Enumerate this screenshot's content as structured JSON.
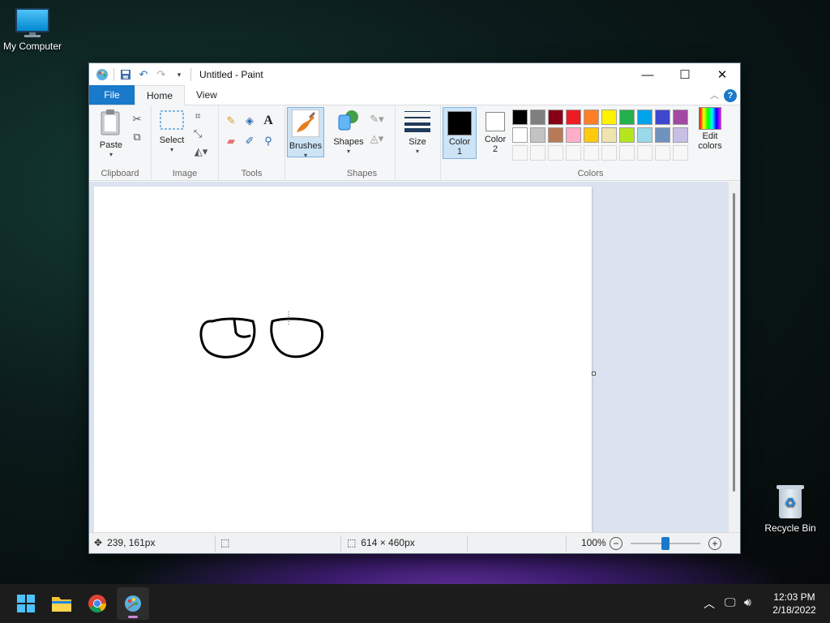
{
  "desktop": {
    "icons": [
      {
        "label": "My Computer",
        "icon": "computer-icon"
      },
      {
        "label": "Recycle Bin",
        "icon": "recycle-bin-icon"
      }
    ]
  },
  "window": {
    "title": "Untitled - Paint",
    "tabs": [
      "File",
      "Home",
      "View"
    ],
    "groups": {
      "clipboard": {
        "label": "Clipboard",
        "paste": "Paste"
      },
      "image": {
        "label": "Image",
        "select": "Select"
      },
      "tools": {
        "label": "Tools"
      },
      "brushes": {
        "label": "Brushes"
      },
      "shapes": {
        "label": "Shapes",
        "shapes_btn": "Shapes"
      },
      "size": {
        "label": "Size"
      },
      "colors": {
        "label": "Colors",
        "color1_line1": "Color",
        "color1_line2": "1",
        "color2_line1": "Color",
        "color2_line2": "2",
        "edit_line1": "Edit",
        "edit_line2": "colors",
        "color1": "#000000",
        "color2": "#ffffff",
        "palette_row1": [
          "#000000",
          "#7f7f7f",
          "#880015",
          "#ed1c24",
          "#ff7f27",
          "#fff200",
          "#22b14c",
          "#00a2e8",
          "#3f48cc",
          "#a349a4"
        ],
        "palette_row2": [
          "#ffffff",
          "#c3c3c3",
          "#b97a57",
          "#ffaec9",
          "#ffc90e",
          "#efe4b0",
          "#b5e61d",
          "#99d9ea",
          "#7092be",
          "#c8bfe7"
        ]
      }
    },
    "status": {
      "cursor_pos": "239, 161px",
      "canvas_size": "614 × 460px",
      "zoom": "100%",
      "zoom_fraction": 0.5
    }
  },
  "taskbar": {
    "apps": [
      "start-icon",
      "file-explorer-icon",
      "chrome-icon",
      "paint-icon"
    ],
    "time": "12:03 PM",
    "date": "2/18/2022"
  }
}
